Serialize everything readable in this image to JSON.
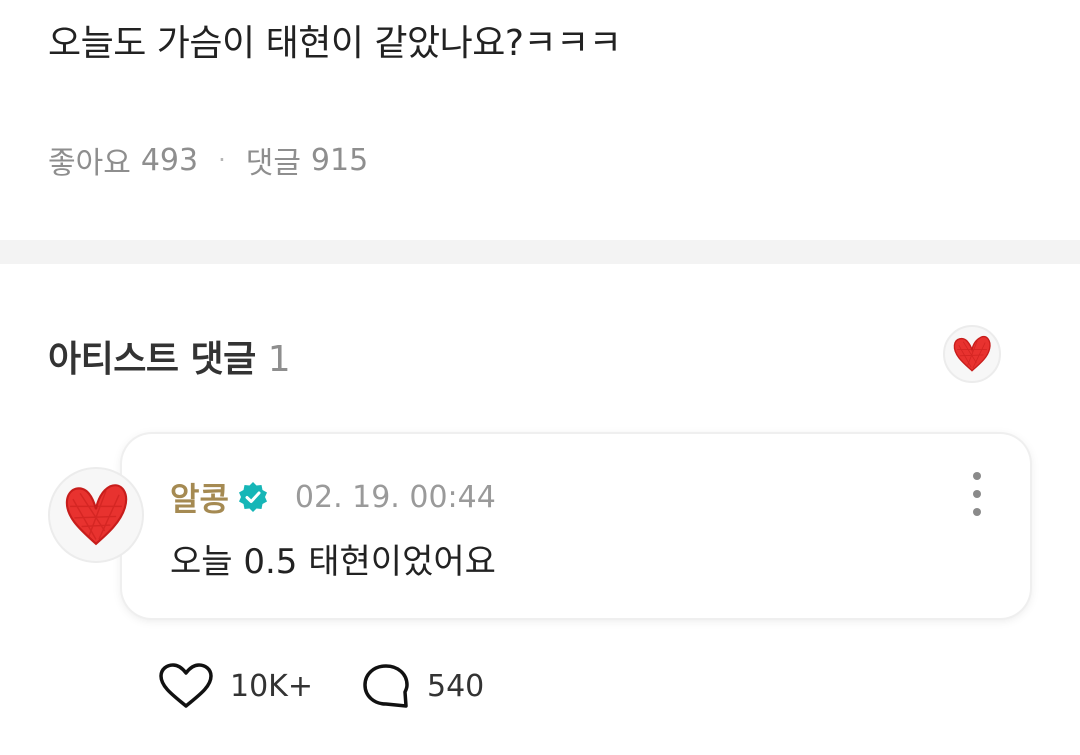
{
  "post": {
    "body": "오늘도 가슴이 태현이 같았나요?ㅋㅋㅋ",
    "like_label": "좋아요",
    "like_count": "493",
    "separator": "·",
    "comment_label": "댓글",
    "comment_count": "915"
  },
  "artist_comments": {
    "title": "아티스트 댓글",
    "count": "1"
  },
  "comment": {
    "author": "알콩",
    "timestamp": "02. 19. 00:44",
    "text": "오늘 0.5 태현이었어요",
    "like_count": "10K+",
    "reply_count": "540"
  },
  "colors": {
    "author": "#a58a52",
    "verified_badge": "#16b6b7",
    "heart": "#e8322f",
    "divider": "#f3f3f3"
  },
  "icons": {
    "verified": "verified-badge-icon",
    "more": "more-vertical-icon",
    "like": "heart-outline-icon",
    "reply": "speech-bubble-icon",
    "avatar": "red-heart-drawing"
  }
}
